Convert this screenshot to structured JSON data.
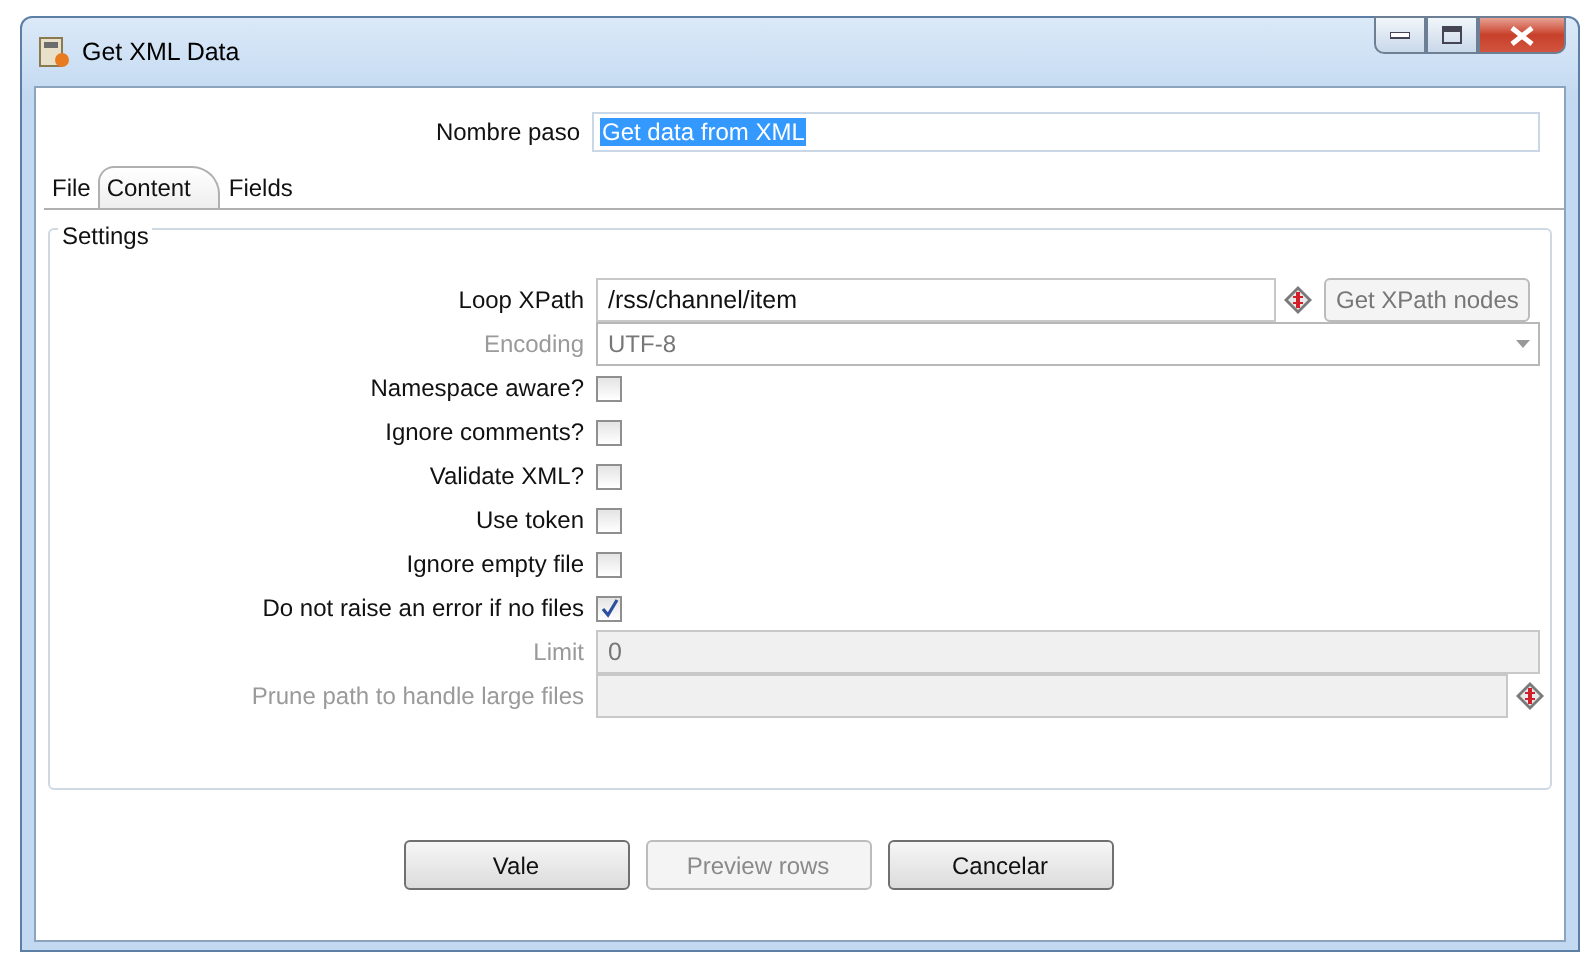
{
  "window": {
    "title": "Get XML Data"
  },
  "step_name": {
    "label": "Nombre paso",
    "value": "Get data from XML"
  },
  "tabs": [
    {
      "label": "File",
      "selected": false
    },
    {
      "label": "Content",
      "selected": true
    },
    {
      "label": "Fields",
      "selected": false
    }
  ],
  "settings": {
    "title": "Settings",
    "rows": [
      {
        "kind": "text",
        "label": "Loop XPath",
        "value": "/rss/channel/item",
        "disabled": false,
        "variable": true,
        "button": "Get XPath nodes"
      },
      {
        "kind": "dropdown",
        "label": "Encoding",
        "value": "UTF-8",
        "disabled": true
      },
      {
        "kind": "checkbox",
        "label": "Namespace aware?",
        "checked": false
      },
      {
        "kind": "checkbox",
        "label": "Ignore comments?",
        "checked": false
      },
      {
        "kind": "checkbox",
        "label": "Validate XML?",
        "checked": false
      },
      {
        "kind": "checkbox",
        "label": "Use token",
        "checked": false
      },
      {
        "kind": "checkbox",
        "label": "Ignore empty file",
        "checked": false
      },
      {
        "kind": "checkbox",
        "label": "Do not raise an error if no files",
        "checked": true
      },
      {
        "kind": "text",
        "label": "Limit",
        "value": "0",
        "disabled": true,
        "variable": false
      },
      {
        "kind": "text",
        "label": "Prune path to handle large files",
        "value": "",
        "disabled": true,
        "variable": true
      }
    ]
  },
  "buttons": [
    {
      "label": "Vale",
      "disabled": false
    },
    {
      "label": "Preview rows",
      "disabled": true
    },
    {
      "label": "Cancelar",
      "disabled": false
    }
  ]
}
